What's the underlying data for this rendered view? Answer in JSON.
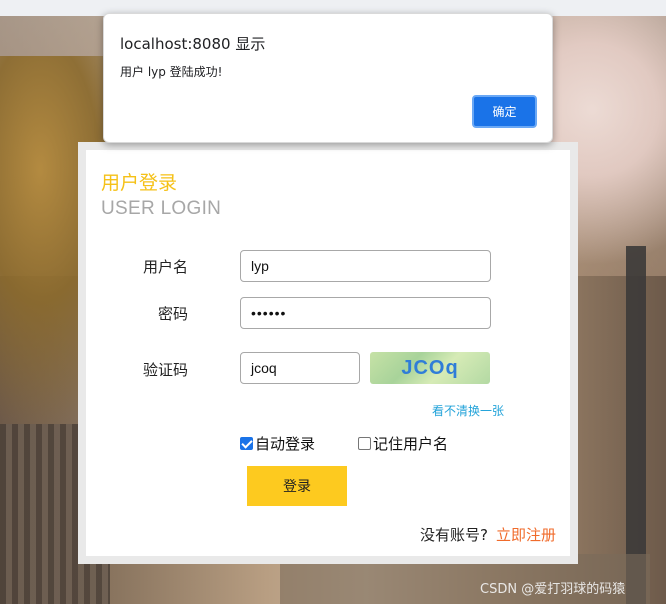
{
  "dialog": {
    "title": "localhost:8080 显示",
    "message": "用户 lyp 登陆成功!",
    "ok_label": "确定"
  },
  "login": {
    "title_cn": "用户登录",
    "title_en": "USER LOGIN",
    "username_label": "用户名",
    "username_value": "lyp",
    "password_label": "密码",
    "password_value": "••••••",
    "captcha_label": "验证码",
    "captcha_value": "jcoq",
    "captcha_image_text": "JCOq",
    "refresh_label": "看不清换一张",
    "auto_login_label": "自动登录",
    "auto_login_checked": true,
    "remember_label": "记住用户名",
    "remember_checked": false,
    "submit_label": "登录",
    "no_account_text": "没有账号?",
    "register_label": "立即注册"
  },
  "watermark": "CSDN @爱打羽球的码猿",
  "colors": {
    "accent_yellow": "#fdca1f",
    "title_yellow": "#f5c118",
    "link_blue": "#23a3d9",
    "register_orange": "#f06b2b",
    "dialog_button": "#1a73e8"
  }
}
